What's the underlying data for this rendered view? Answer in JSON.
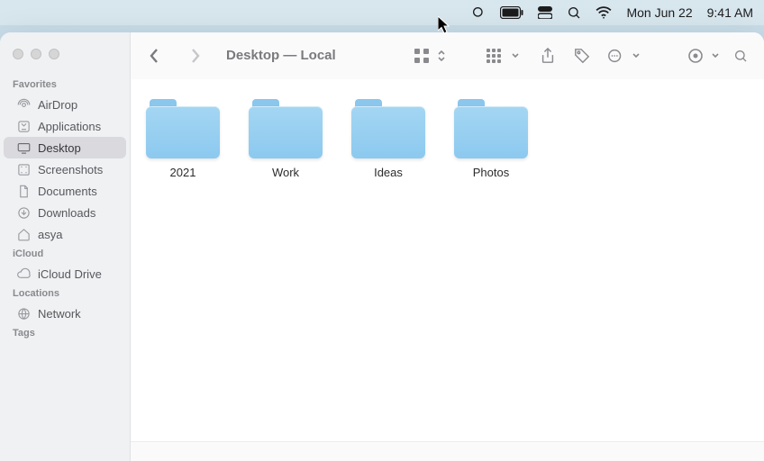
{
  "menubar": {
    "date": "Mon Jun 22",
    "time": "9:41 AM"
  },
  "window": {
    "title": "Desktop — Local",
    "traffic": {
      "close": "close",
      "min": "minimize",
      "max": "zoom"
    }
  },
  "sidebar": {
    "sections": [
      {
        "label": "Favorites",
        "items": [
          {
            "name": "AirDrop",
            "icon": "airdrop"
          },
          {
            "name": "Applications",
            "icon": "apps"
          },
          {
            "name": "Desktop",
            "icon": "desktop",
            "selected": true
          },
          {
            "name": "Screenshots",
            "icon": "screenshots"
          },
          {
            "name": "Documents",
            "icon": "documents"
          },
          {
            "name": "Downloads",
            "icon": "downloads"
          },
          {
            "name": "asya",
            "icon": "home"
          }
        ]
      },
      {
        "label": "iCloud",
        "items": [
          {
            "name": "iCloud Drive",
            "icon": "cloud"
          }
        ]
      },
      {
        "label": "Locations",
        "items": [
          {
            "name": "Network",
            "icon": "network"
          }
        ]
      },
      {
        "label": "Tags",
        "items": []
      }
    ]
  },
  "folders": [
    {
      "name": "2021"
    },
    {
      "name": "Work"
    },
    {
      "name": "Ideas"
    },
    {
      "name": "Photos"
    }
  ],
  "statusbar": {
    "text": ""
  }
}
